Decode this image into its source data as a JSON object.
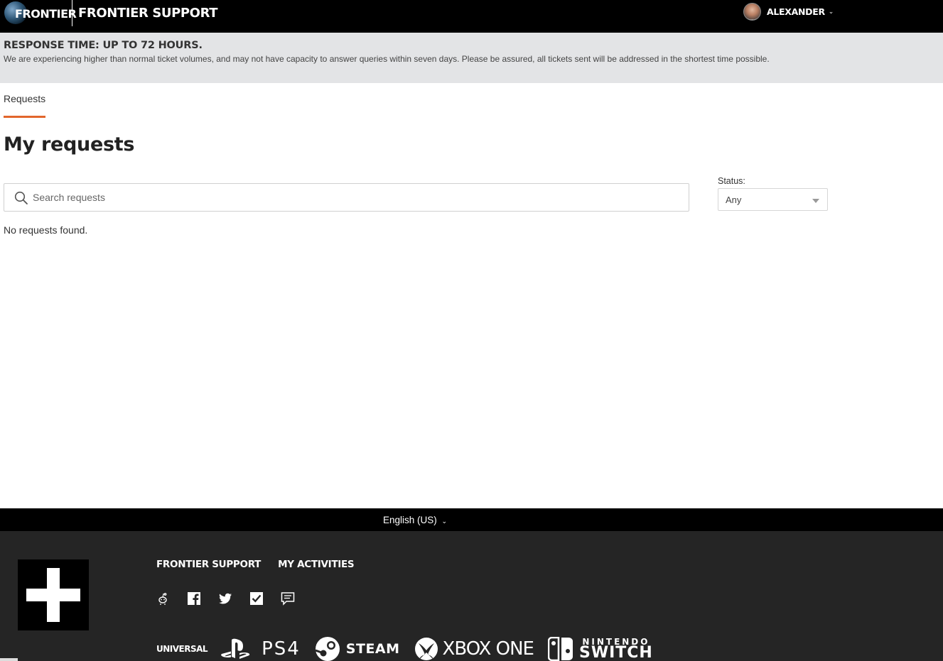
{
  "header": {
    "logo_text": "FRONTIER",
    "site_title": "FRONTIER SUPPORT",
    "user_name": "ALEXANDER"
  },
  "notice": {
    "title": "RESPONSE TIME: UP TO 72 HOURS.",
    "text": "We are experiencing higher than normal ticket volumes, and may not have capacity to answer queries within seven days. Please be assured, all tickets sent will be addressed in the shortest time possible."
  },
  "tabs": [
    {
      "label": "Requests",
      "active": true
    }
  ],
  "main": {
    "title": "My requests",
    "search_placeholder": "Search requests",
    "status_label": "Status:",
    "status_value": "Any",
    "empty_text": "No requests found."
  },
  "footer": {
    "language": "English (US)",
    "links": [
      "FRONTIER SUPPORT",
      "MY ACTIVITIES"
    ],
    "socials": [
      "reddit-icon",
      "facebook-icon",
      "twitter-icon",
      "checkbox-icon",
      "chat-icon"
    ],
    "brands": {
      "universal": "UNIVERSAL",
      "ps4": "PS4",
      "steam": "STEAM",
      "xbox": "XBOX ONE",
      "nintendo_top": "NINTENDO",
      "nintendo_bottom": "SWITCH"
    }
  },
  "colors": {
    "accent": "#e2662c",
    "header_bg": "#000000",
    "notice_bg": "#e3e4e6",
    "footer_bg": "#252525"
  }
}
